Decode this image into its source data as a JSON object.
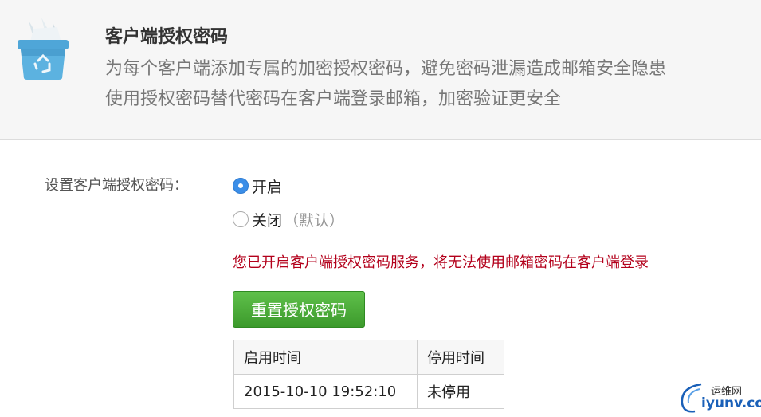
{
  "header": {
    "title": "客户端授权密码",
    "desc_line1": "为每个客户端添加专属的加密授权密码，避免密码泄漏造成邮箱安全隐患",
    "desc_line2": "使用授权密码替代密码在客户端登录邮箱，加密验证更安全",
    "icon": "recycle-bin-icon"
  },
  "setting": {
    "label": "设置客户端授权密码：",
    "options": [
      {
        "label": "开启",
        "selected": true
      },
      {
        "label": "关闭",
        "note": "（默认）",
        "selected": false
      }
    ],
    "warning": "您已开启客户端授权密码服务，将无法使用邮箱密码在客户端登录",
    "reset_button": "重置授权密码"
  },
  "time_table": {
    "headers": [
      "启用时间",
      "停用时间"
    ],
    "rows": [
      [
        "2015-10-10 19:52:10",
        "未停用"
      ]
    ]
  },
  "watermark": {
    "top_text": "运维网",
    "bottom_text": "iyunv.com"
  },
  "colors": {
    "accent_blue": "#3b8ee8",
    "warning_red": "#b3001b",
    "button_green": "#4caf3a"
  }
}
